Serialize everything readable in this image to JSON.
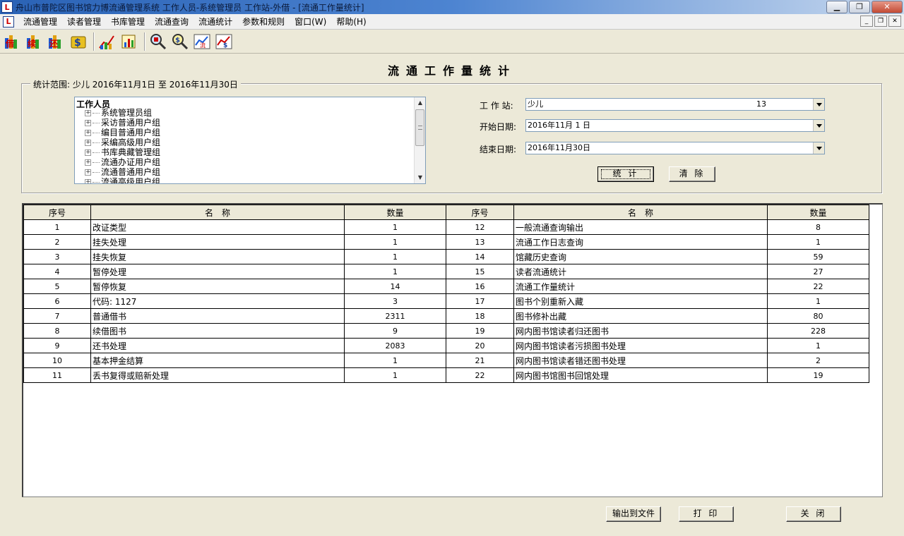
{
  "window": {
    "title": "舟山市普陀区图书馆力博流通管理系统 工作人员-系统管理员 工作站-外借 - [流通工作量统计]",
    "app_icon_text": "L"
  },
  "menu": [
    "流通管理",
    "读者管理",
    "书库管理",
    "流通查询",
    "流通统计",
    "参数和规则",
    "窗口(W)",
    "帮助(H)"
  ],
  "toolbar_icons": [
    "borrow-icon",
    "renew-icon",
    "return-icon",
    "payment-icon",
    "reader-stats-icon",
    "book-stats-icon",
    "reader-query-icon",
    "payment-query-icon",
    "circulation-chart-icon",
    "money-chart-icon"
  ],
  "form": {
    "title": "流通工作量统计",
    "range_label": "统计范围:",
    "range_value": "少儿 2016年11月1日 至 2016年11月30日",
    "tree_root": "工作人员",
    "tree_nodes": [
      "系统管理员组",
      "采访普通用户组",
      "编目普通用户组",
      "采编高级用户组",
      "书库典藏管理组",
      "流通办证用户组",
      "流通普通用户组",
      "流通高级用户组"
    ],
    "workstation_label": "工 作 站:",
    "workstation_value": "少儿",
    "workstation_code": "13",
    "start_label": "开始日期:",
    "start_value": "2016年11月 1 日",
    "end_label": "结束日期:",
    "end_value": "2016年11月30日",
    "stat_button": "统 计",
    "clear_button": "清 除"
  },
  "table": {
    "headers": [
      "序号",
      "名　称",
      "数量",
      "序号",
      "名　称",
      "数量"
    ],
    "left_rows": [
      {
        "no": "1",
        "name": "改证类型",
        "qty": "1"
      },
      {
        "no": "2",
        "name": "挂失处理",
        "qty": "1"
      },
      {
        "no": "3",
        "name": "挂失恢复",
        "qty": "1"
      },
      {
        "no": "4",
        "name": "暂停处理",
        "qty": "1"
      },
      {
        "no": "5",
        "name": "暂停恢复",
        "qty": "14"
      },
      {
        "no": "6",
        "name": "代码: 1127",
        "qty": "3"
      },
      {
        "no": "7",
        "name": "普通借书",
        "qty": "2311"
      },
      {
        "no": "8",
        "name": "续借图书",
        "qty": "9"
      },
      {
        "no": "9",
        "name": "还书处理",
        "qty": "2083"
      },
      {
        "no": "10",
        "name": "基本押金结算",
        "qty": "1"
      },
      {
        "no": "11",
        "name": "丢书复得或赔新处理",
        "qty": "1"
      }
    ],
    "right_rows": [
      {
        "no": "12",
        "name": "一般流通查询输出",
        "qty": "8"
      },
      {
        "no": "13",
        "name": "流通工作日志查询",
        "qty": "1"
      },
      {
        "no": "14",
        "name": "馆藏历史查询",
        "qty": "59"
      },
      {
        "no": "15",
        "name": "读者流通统计",
        "qty": "27"
      },
      {
        "no": "16",
        "name": "流通工作量统计",
        "qty": "22"
      },
      {
        "no": "17",
        "name": "图书个别重新入藏",
        "qty": "1"
      },
      {
        "no": "18",
        "name": "图书修补出藏",
        "qty": "80"
      },
      {
        "no": "19",
        "name": "网内图书馆读者归还图书",
        "qty": "228"
      },
      {
        "no": "20",
        "name": "网内图书馆读者污损图书处理",
        "qty": "1"
      },
      {
        "no": "21",
        "name": "网内图书馆读者错还图书处理",
        "qty": "2"
      },
      {
        "no": "22",
        "name": "网内图书馆图书回馆处理",
        "qty": "19"
      }
    ]
  },
  "bottom_buttons": {
    "export": "输出到文件",
    "print": "打 印",
    "close": "关 闭"
  }
}
